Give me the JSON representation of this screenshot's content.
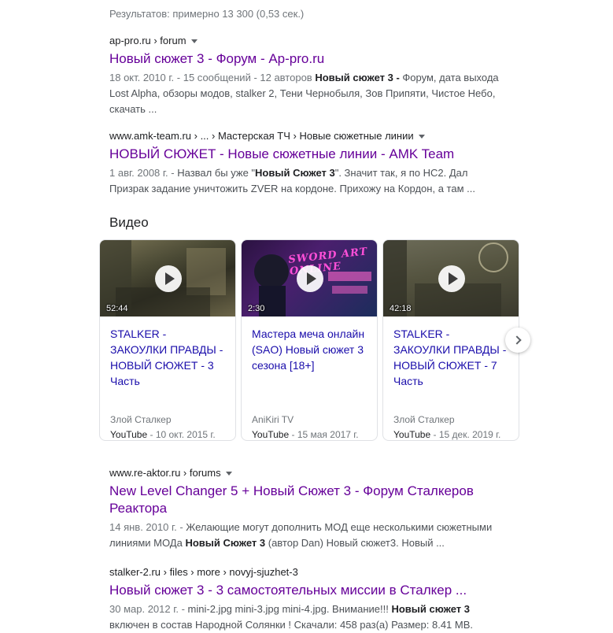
{
  "stats": "Результатов: примерно 13 300 (0,53 сек.)",
  "results_top": [
    {
      "breadcrumb": "ap-pro.ru › forum",
      "title": "Новый сюжет 3 - Форум - Ap-pro.ru",
      "snippet_date": "18 окт. 2010 г. - 15 сообщений - 12 авторов",
      "snippet_bold": "Новый сюжет 3 -",
      "snippet_rest": " Форум, дата выхода Lost Alpha, обзоры модов, stalker 2, Тени Чернобыля, Зов Припяти, Чистое Небо, скачать ..."
    },
    {
      "breadcrumb": "www.amk-team.ru › ... › Мастерская ТЧ › Новые сюжетные линии",
      "title": "НОВЫЙ СЮЖЕТ - Новые сюжетные линии - AMK Team",
      "snippet_date": "1 авг. 2008 г. -",
      "snippet_pre": " Назвал бы уже \"",
      "snippet_bold": "Новый Сюжет 3",
      "snippet_rest": "\". Значит так, я по НС2. Дал Призрак задание уничтожить ZVER на кордоне. Прихожу на Кордон, а там ..."
    }
  ],
  "videos": {
    "heading": "Видео",
    "items": [
      {
        "duration": "52:44",
        "title": "STALKER - ЗАКОУЛКИ ПРАВДЫ - НОВЫЙ СЮЖЕТ - 3 Часть",
        "author": "Злой Сталкер",
        "source": "YouTube",
        "date": "- 10 окт. 2015 г."
      },
      {
        "duration": "2:30",
        "title": "Мастера меча онлайн (SAO) Новый сюжет 3 сезона [18+]",
        "author": "AniKiri TV",
        "source": "YouTube",
        "date": "- 15 мая 2017 г.",
        "thumb_text": "SWORD ART ONLINE"
      },
      {
        "duration": "42:18",
        "title": "STALKER - ЗАКОУЛКИ ПРАВДЫ - НОВЫЙ СЮЖЕТ - 7 Часть",
        "author": "Злой Сталкер",
        "source": "YouTube",
        "date": "- 15 дек. 2019 г."
      }
    ]
  },
  "results_bottom": [
    {
      "breadcrumb": "www.re-aktor.ru › forums",
      "title": "New Level Changer 5 + Новый Сюжет 3 - Форум Сталкеров Реактора",
      "snippet_date": "14 янв. 2010 г. -",
      "snippet_pre": " Желающие могут дополнить МОД еще несколькими сюжетными линиями МОДа ",
      "snippet_bold": "Новый Сюжет 3",
      "snippet_rest": " (автор Dan) Новый сюжет3. Новый ..."
    },
    {
      "breadcrumb": "stalker-2.ru › files › more › novyj-sjuzhet-3",
      "title": "Новый сюжет 3 - 3 самостоятельных миссии в Сталкер ...",
      "snippet_date": "30 мар. 2012 г. -",
      "snippet_pre": " mini-2.jpg mini-3.jpg mini-4.jpg. Внимание!!! ",
      "snippet_bold": "Новый сюжет 3",
      "snippet_rest": " включен в состав Народной Солянки ! Скачали: 458 раз(а) Размер: 8.41 MB."
    }
  ],
  "colors": {
    "visited_link": "#660099",
    "video_link": "#1a0dab",
    "meta": "#70757a"
  }
}
